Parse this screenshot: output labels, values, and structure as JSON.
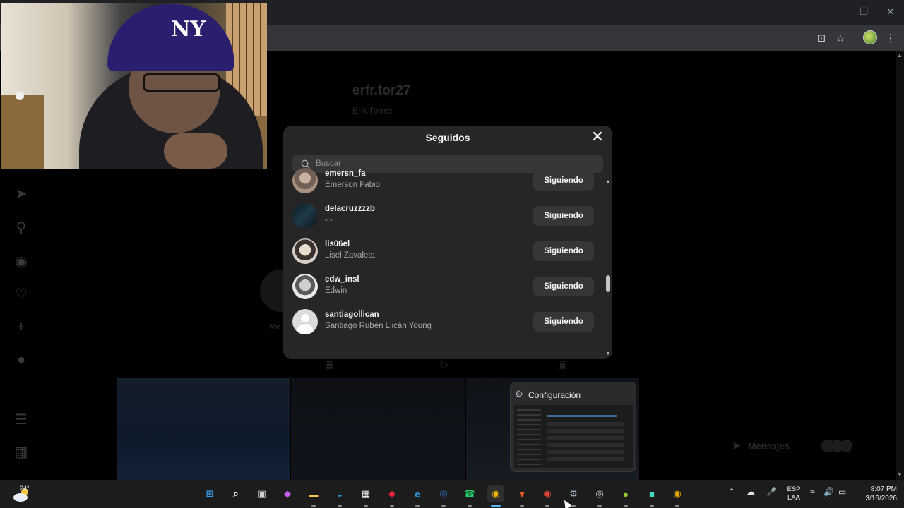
{
  "window": {
    "controls": [
      "minimize",
      "restore",
      "close"
    ]
  },
  "browser_toolbar": {
    "icons": [
      "install-app-icon",
      "bookmark-star-icon",
      "profile-avatar",
      "more-menu-icon"
    ]
  },
  "profile": {
    "username": "erfr.tor27",
    "full_name": "Erik Torres",
    "story_label": "Me"
  },
  "sidebar_icons": [
    "direct-icon",
    "search-icon",
    "explore-icon",
    "heart-icon",
    "create-icon",
    "profile-icon",
    "menu-icon",
    "apps-icon"
  ],
  "messages_button": {
    "label": "Mensajes"
  },
  "modal": {
    "title": "Seguidos",
    "search_placeholder": "Buscar",
    "users": [
      {
        "username": "emersn_fa",
        "full_name": "Emerson Fabio",
        "button": "Siguiendo"
      },
      {
        "username": "delacruzzzzb",
        "full_name": "-.-",
        "button": "Siguiendo"
      },
      {
        "username": "lis06el",
        "full_name": "Lisel Zavaleta",
        "button": "Siguiendo"
      },
      {
        "username": "edw_insl",
        "full_name": "Edwin",
        "button": "Siguiendo"
      },
      {
        "username": "santiagollican",
        "full_name": "Santiago Rubén Llicán Young",
        "button": "Siguiendo"
      }
    ]
  },
  "taskbar_preview": {
    "title": "Configuración"
  },
  "taskbar": {
    "weather_temp": "24°",
    "apps": [
      {
        "name": "start",
        "color": "#3aa0f3"
      },
      {
        "name": "search",
        "color": "#ffffff"
      },
      {
        "name": "task-view",
        "color": "#cfcfcf"
      },
      {
        "name": "copilot",
        "color": "#c65cf0"
      },
      {
        "name": "file-explorer",
        "color": "#f6c343"
      },
      {
        "name": "edge",
        "color": "#1fa0d8"
      },
      {
        "name": "microsoft-store",
        "color": "#ffffff"
      },
      {
        "name": "app-red-diamond",
        "color": "#e8253a"
      },
      {
        "name": "app-ie-like",
        "color": "#2aa3e8"
      },
      {
        "name": "steam",
        "color": "#2a6cb3"
      },
      {
        "name": "whatsapp",
        "color": "#25d366"
      },
      {
        "name": "chrome-active",
        "color": "#f4b400"
      },
      {
        "name": "brave",
        "color": "#f15a24"
      },
      {
        "name": "chrome-2",
        "color": "#db4437"
      },
      {
        "name": "settings",
        "color": "#a9b6c6"
      },
      {
        "name": "app-obs-like",
        "color": "#cfcfcf"
      },
      {
        "name": "app-green-globe",
        "color": "#9acd32"
      },
      {
        "name": "app-discord-like",
        "color": "#3fd9c2"
      },
      {
        "name": "chrome-3",
        "color": "#e8a600"
      }
    ],
    "lang_top": "ESP",
    "lang_bottom": "LAA",
    "time": "8:07 PM",
    "date": "3/16/2026"
  }
}
